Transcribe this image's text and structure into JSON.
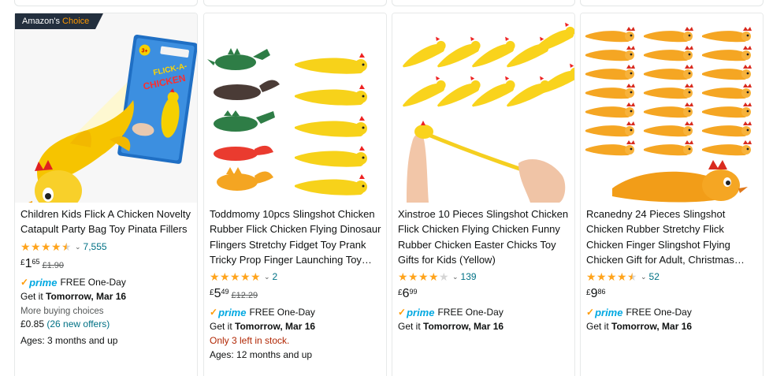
{
  "colors": {
    "star": "#ffa41c",
    "link": "#007185",
    "prime": "#00a8e1",
    "stock_warning": "#b12704",
    "badge_bg": "#232f3e",
    "badge_accent": "#ff9900"
  },
  "products": [
    {
      "badge": {
        "prefix": "Amazon's",
        "highlight": "Choice"
      },
      "title": "Children Kids Flick A Chicken Novelty Catapult Party Bag Toy Pinata Fillers",
      "rating": 4.5,
      "review_count": "7,555",
      "price": {
        "currency": "£",
        "whole": "1",
        "fraction": "65"
      },
      "was_price": "£1.90",
      "prime_label": "prime",
      "delivery_type": "FREE One-Day",
      "get_it_prefix": "Get it",
      "get_it_date": "Tomorrow, Mar 16",
      "more_buying": "More buying choices",
      "offer_price": "£0.85",
      "offer_link": "(26 new offers)",
      "ages": "Ages: 3 months and up"
    },
    {
      "title": "Toddmomy 10pcs Slingshot Chicken Rubber Flick Chicken Flying Dinosaur Flingers Stretchy Fidget Toy Prank Tricky Prop Finger Launching Toy…",
      "rating": 5,
      "review_count": "2",
      "price": {
        "currency": "£",
        "whole": "5",
        "fraction": "49"
      },
      "was_price": "£12.29",
      "prime_label": "prime",
      "delivery_type": "FREE One-Day",
      "get_it_prefix": "Get it",
      "get_it_date": "Tomorrow, Mar 16",
      "stock": "Only 3 left in stock.",
      "ages": "Ages: 12 months and up"
    },
    {
      "title": "Xinstroe 10 Pieces Slingshot Chicken Flick Chicken Flying Chicken Funny Rubber Chicken Easter Chicks Toy Gifts for Kids (Yellow)",
      "rating": 4,
      "review_count": "139",
      "price": {
        "currency": "£",
        "whole": "6",
        "fraction": "99"
      },
      "prime_label": "prime",
      "delivery_type": "FREE One-Day",
      "get_it_prefix": "Get it",
      "get_it_date": "Tomorrow, Mar 16"
    },
    {
      "title": "Rcanedny 24 Pieces Slingshot Chicken Rubber Stretchy Flick Chicken Finger Slingshot Flying Chicken Gift for Adult, Christmas…",
      "rating": 4.5,
      "review_count": "52",
      "price": {
        "currency": "£",
        "whole": "9",
        "fraction": "86"
      },
      "prime_label": "prime",
      "delivery_type": "FREE One-Day",
      "get_it_prefix": "Get it",
      "get_it_date": "Tomorrow, Mar 16"
    }
  ],
  "images": [
    {
      "package_text": "FLICK-A-CHICKEN",
      "package_age": "3+"
    }
  ]
}
